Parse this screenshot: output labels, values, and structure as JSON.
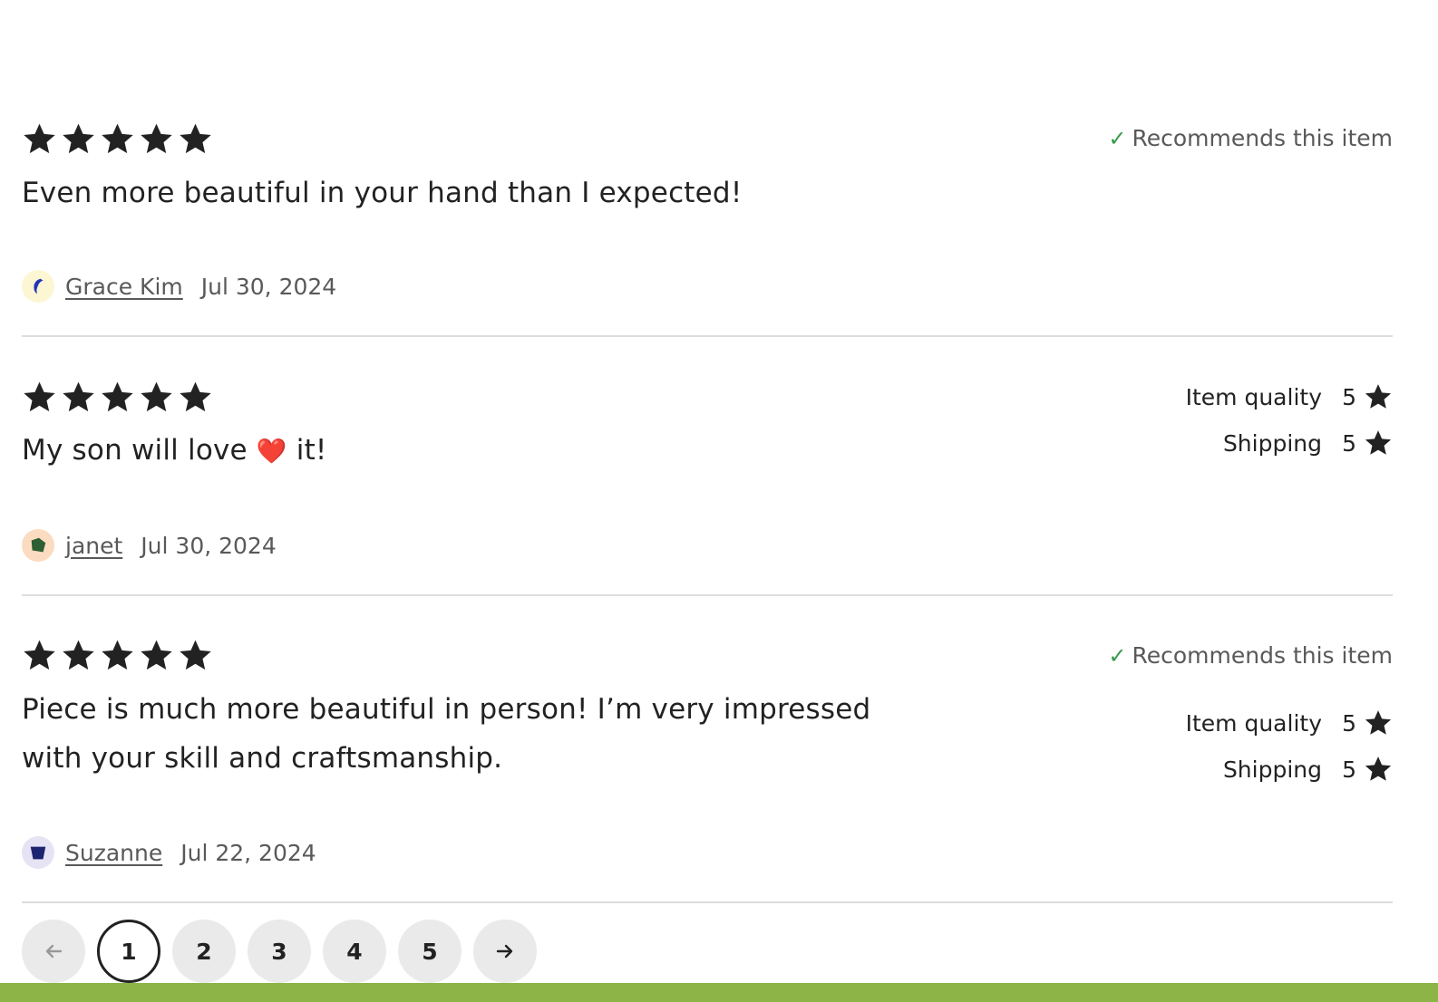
{
  "colors": {
    "star": "#222222",
    "check": "#3a9a4a",
    "divider": "#dddddd",
    "muted_text": "#595959",
    "page_button_bg": "#eaeaea",
    "bottom_bar": "#8db446"
  },
  "reviews": [
    {
      "rating": 5,
      "text": "Even more beautiful in your hand than I expected!",
      "recommends": "Recommends this item",
      "reviewer": "Grace Kim",
      "date": "Jul 30, 2024",
      "avatar_icon": "moon-avatar-icon"
    },
    {
      "rating": 5,
      "text_before": "My son will love",
      "text_emoji": "❤️",
      "text_after": "it!",
      "item_quality_label": "Item quality",
      "item_quality_value": "5",
      "shipping_label": "Shipping",
      "shipping_value": "5",
      "reviewer": "janet",
      "date": "Jul 30, 2024",
      "avatar_icon": "pentagon-avatar-icon"
    },
    {
      "rating": 5,
      "text_line1": "Piece is much more beautiful in person! I’m very impressed",
      "text_line2": "with your skill and craftsmanship.",
      "recommends": "Recommends this item",
      "item_quality_label": "Item quality",
      "item_quality_value": "5",
      "shipping_label": "Shipping",
      "shipping_value": "5",
      "reviewer": "Suzanne",
      "date": "Jul 22, 2024",
      "avatar_icon": "cup-avatar-icon"
    }
  ],
  "pagination": {
    "prev_icon": "arrow-left-icon",
    "pages": [
      "1",
      "2",
      "3",
      "4",
      "5"
    ],
    "current_page": "1",
    "next_icon": "arrow-right-icon"
  }
}
